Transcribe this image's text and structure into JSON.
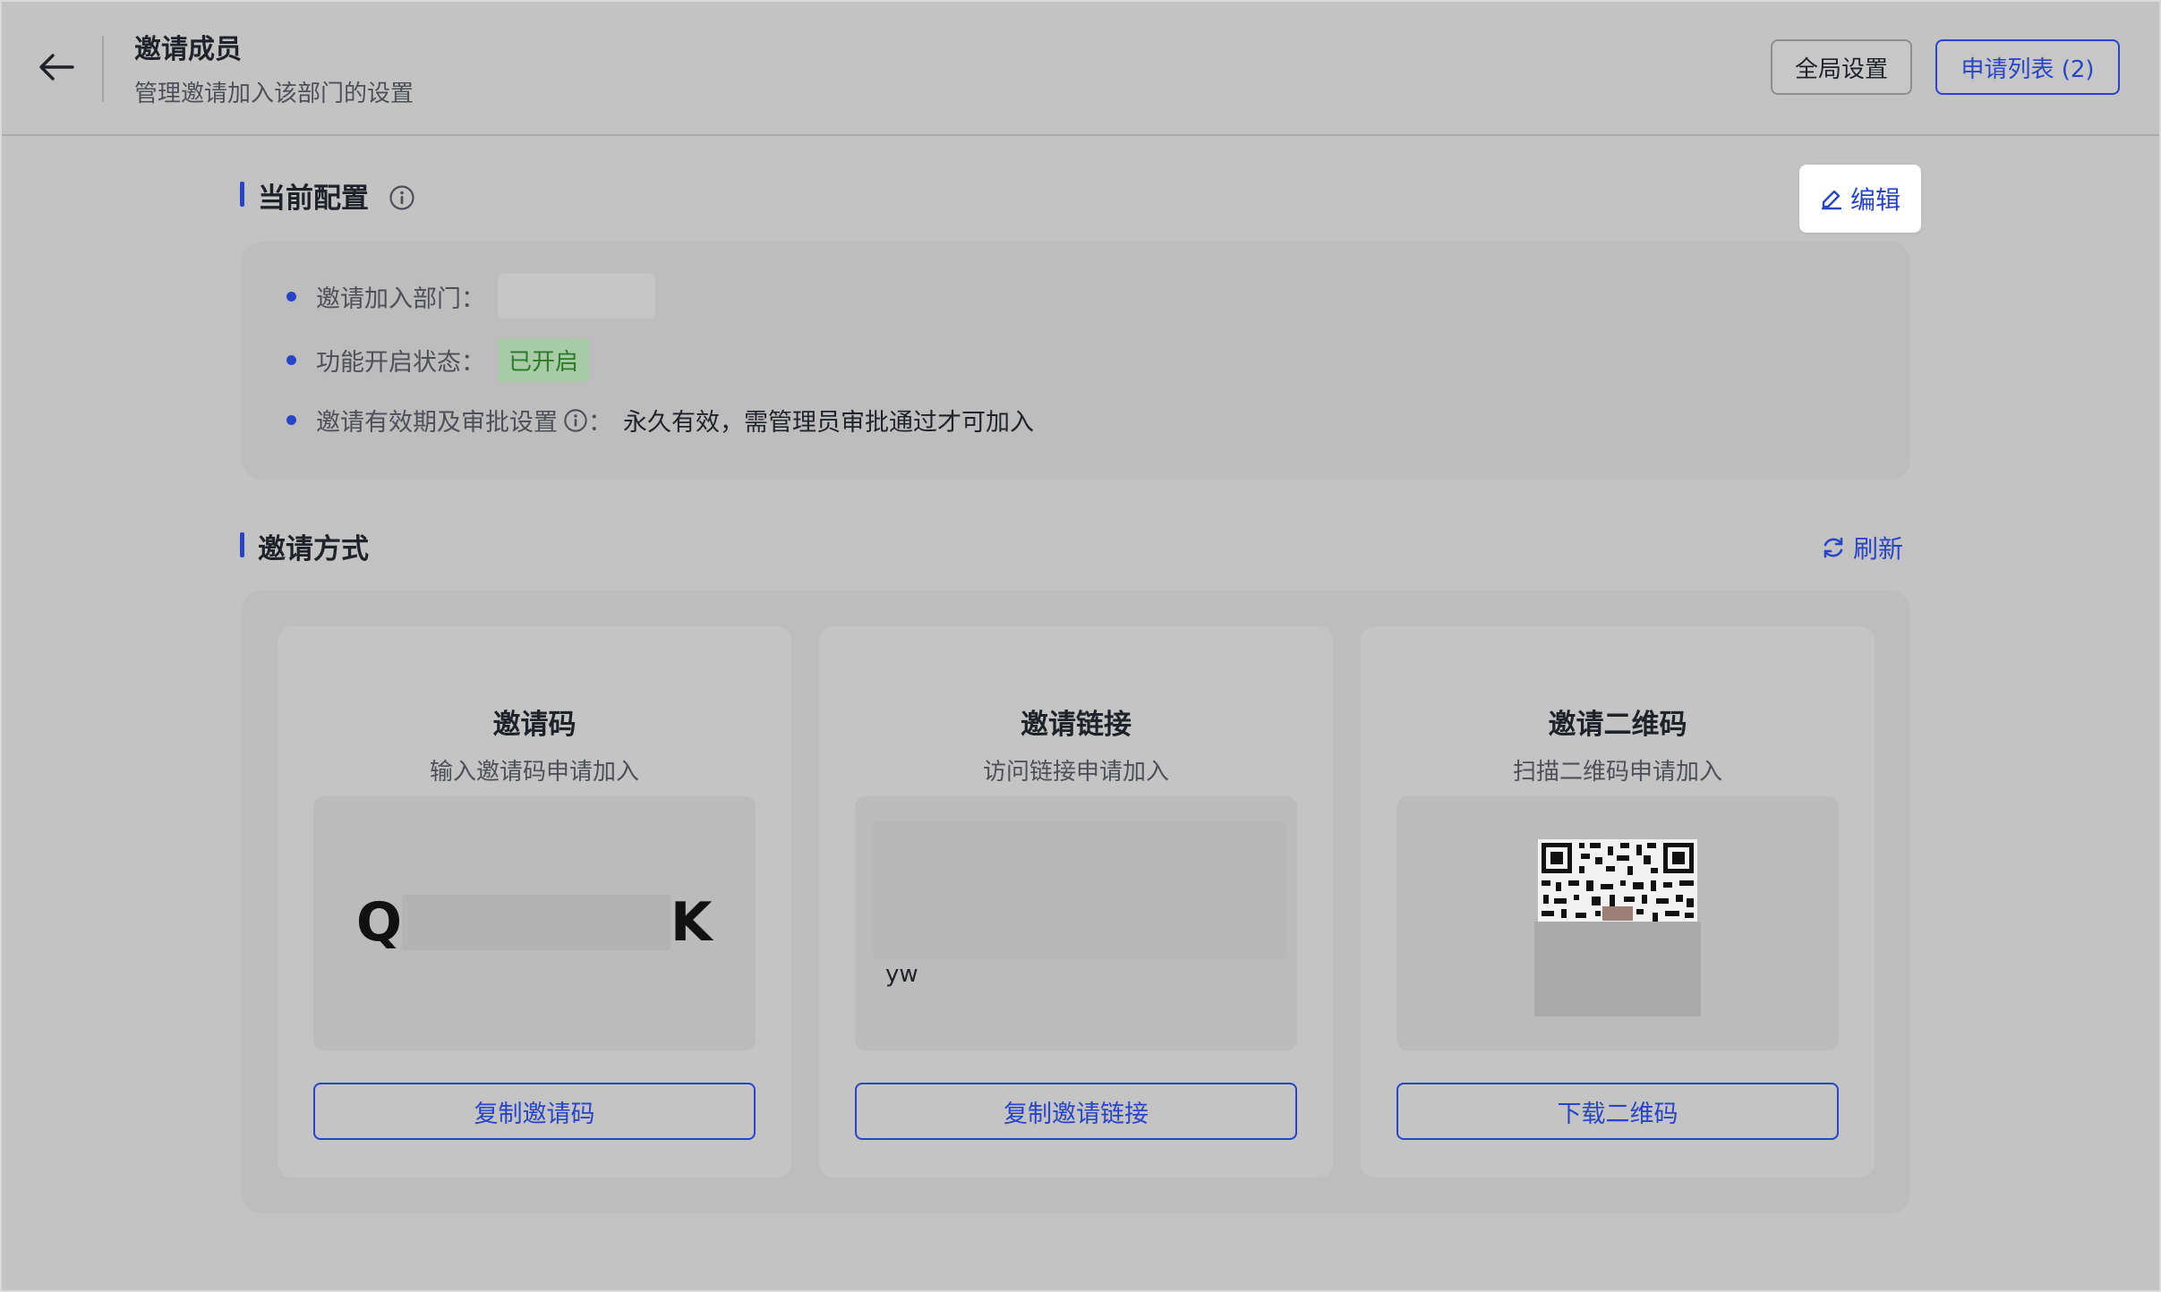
{
  "header": {
    "title": "邀请成员",
    "subtitle": "管理邀请加入该部门的设置",
    "global_settings_label": "全局设置",
    "apply_list_label": "申请列表 (2)"
  },
  "current_config": {
    "title": "当前配置",
    "edit_label": "编辑",
    "rows": [
      {
        "label": "邀请加入部门："
      },
      {
        "label": "功能开启状态：",
        "value": "已开启"
      },
      {
        "label": "邀请有效期及审批设置",
        "suffix": "：",
        "value": "永久有效，需管理员审批通过才可加入"
      }
    ]
  },
  "invite_methods": {
    "title": "邀请方式",
    "refresh_label": "刷新",
    "cards": [
      {
        "title": "邀请码",
        "subtitle": "输入邀请码申请加入",
        "code_start": "Q",
        "code_end": "K",
        "button": "复制邀请码"
      },
      {
        "title": "邀请链接",
        "subtitle": "访问链接申请加入",
        "link_tail": "yw",
        "button": "复制邀请链接"
      },
      {
        "title": "邀请二维码",
        "subtitle": "扫描二维码申请加入",
        "button": "下载二维码"
      }
    ]
  },
  "colors": {
    "accent": "#2845c9",
    "background": "#c3c3c3",
    "status_green": "#2a7a2a"
  },
  "icons": [
    "back-arrow-icon",
    "info-icon",
    "edit-pencil-icon",
    "refresh-icon",
    "qr-code-icon"
  ]
}
